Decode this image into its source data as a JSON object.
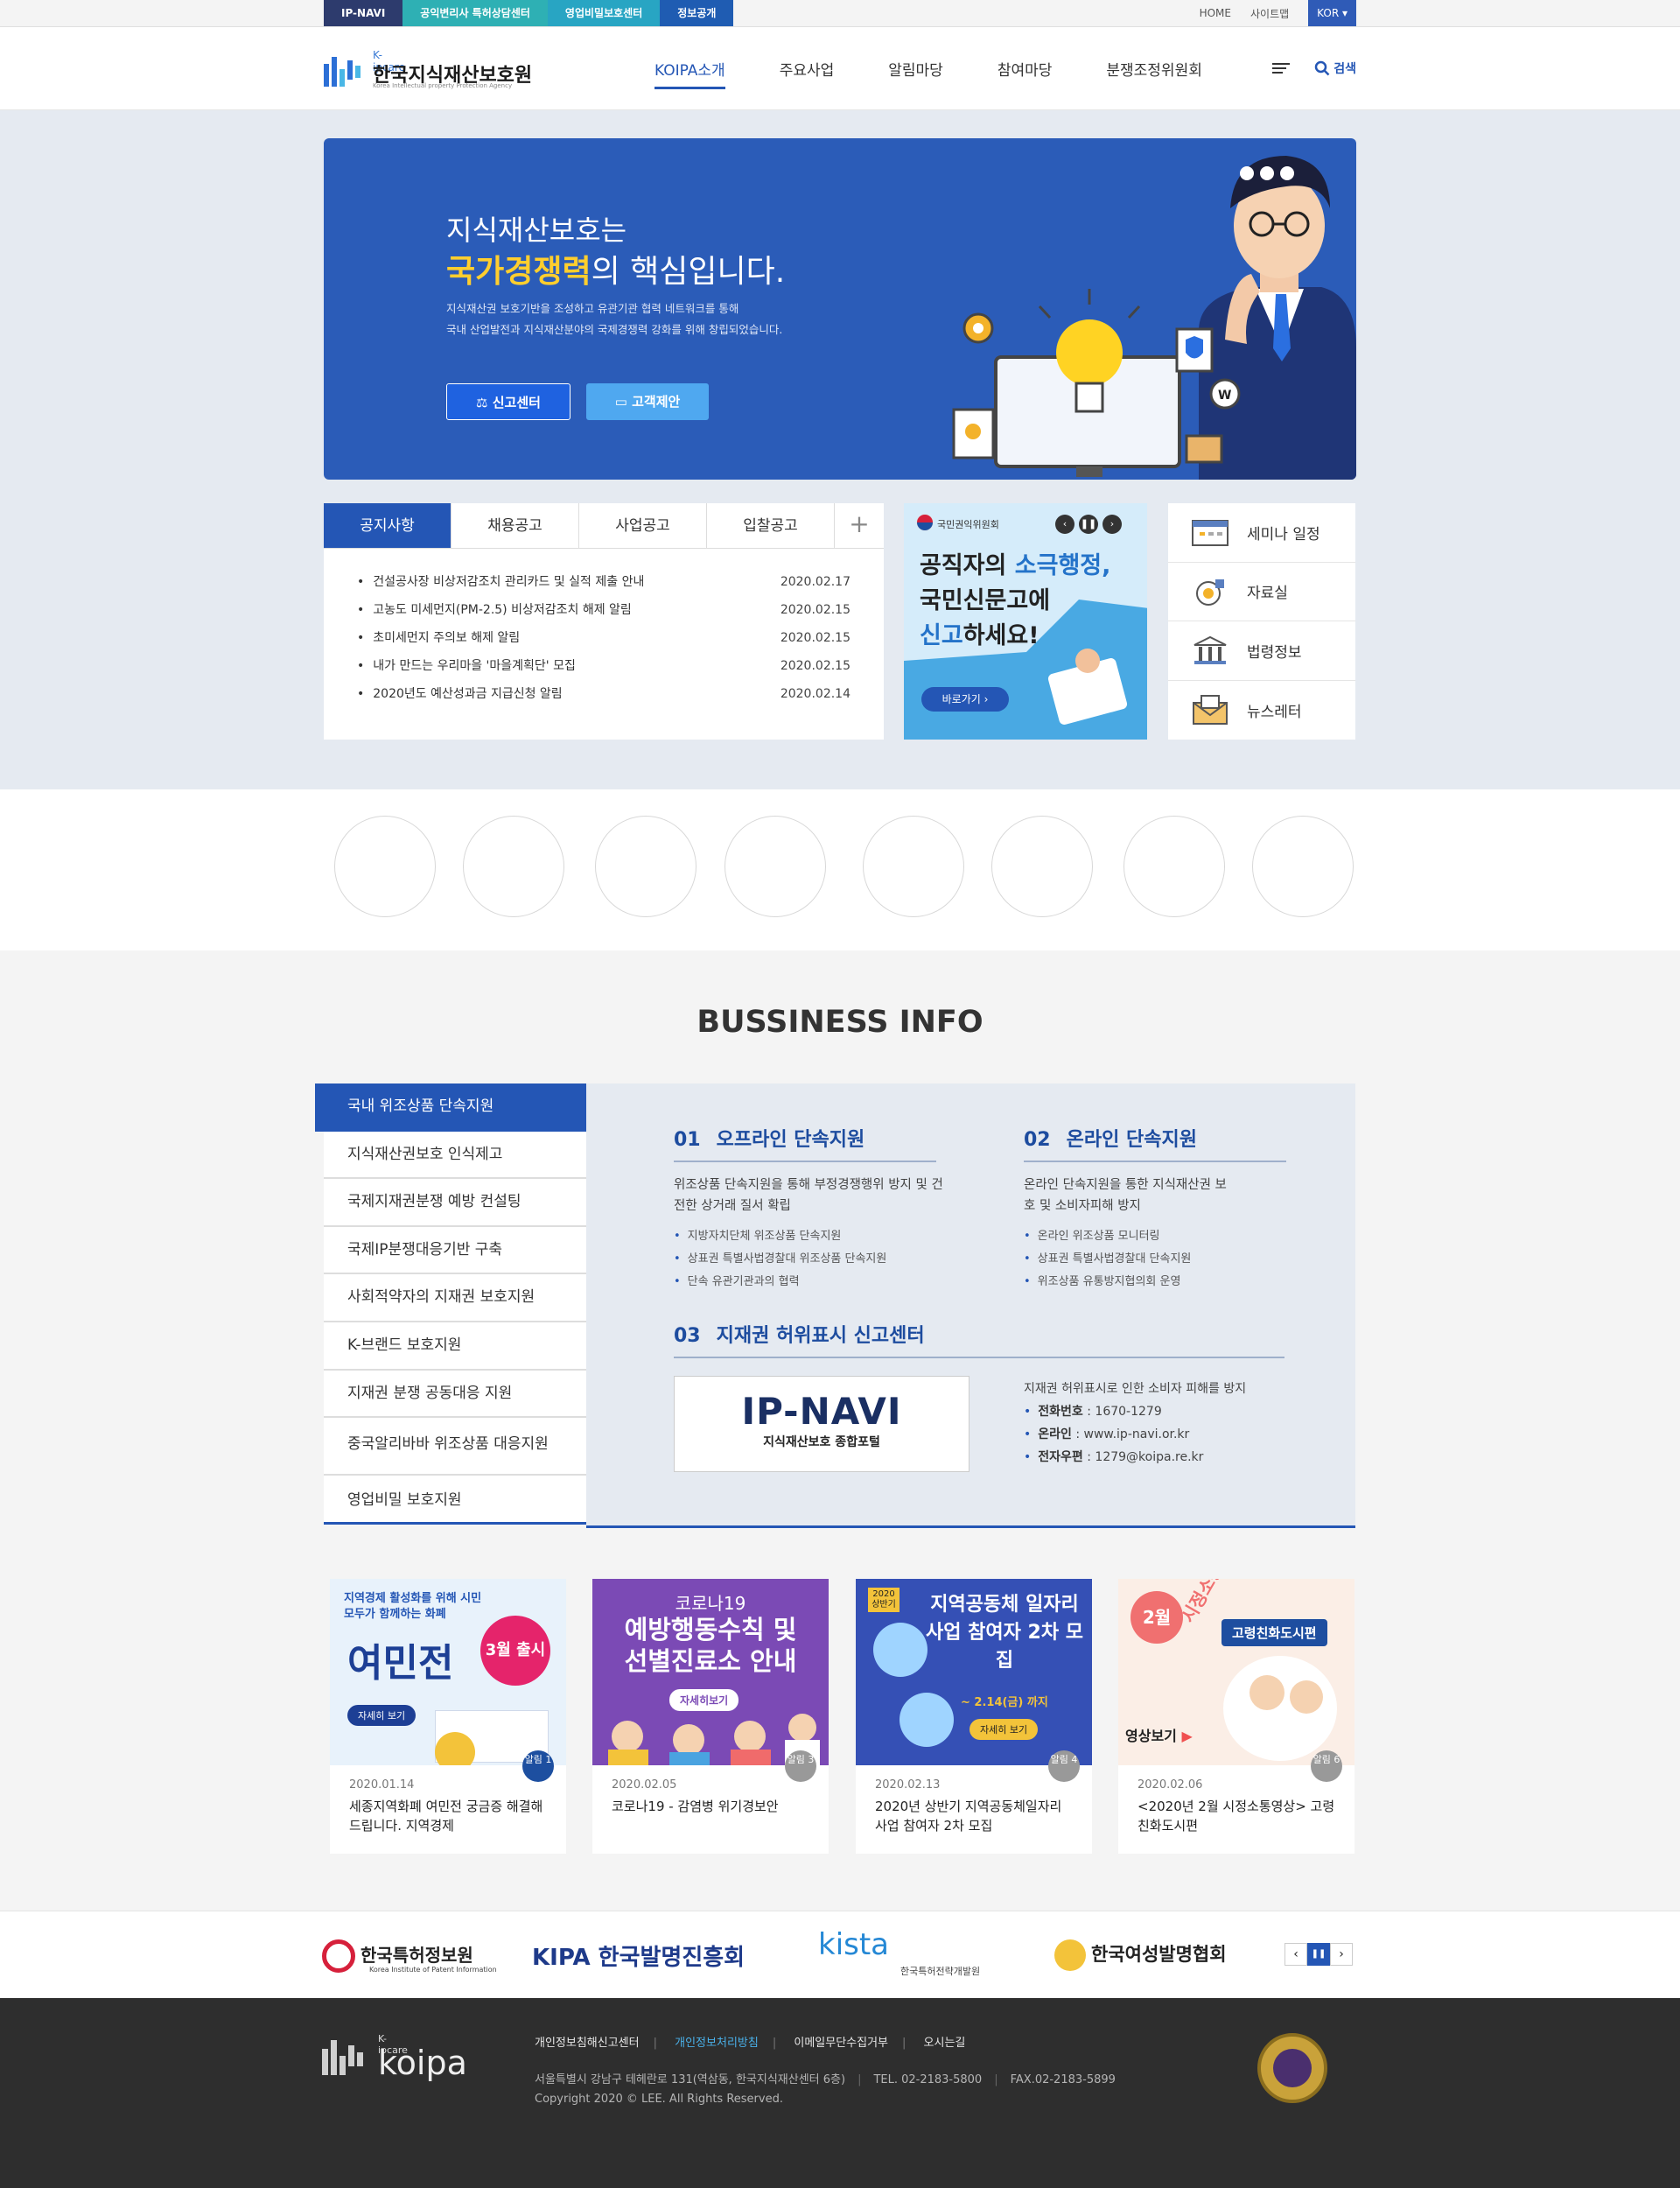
{
  "topbar": {
    "tabs": [
      "IP-NAVI",
      "공익변리사 특허상담센터",
      "영업비밀보호센터",
      "정보공개"
    ],
    "tab_colors": [
      "#2d3b6d",
      "#2eb0b4",
      "#28a5c3",
      "#1f5cb2"
    ],
    "home": "HOME",
    "sitemap": "사이트맵",
    "lang": "KOR"
  },
  "header": {
    "logo_sub": "K-ipcare",
    "logo_name": "한국지식재산보호원",
    "logo_en": "Korea Intellectual property Protection Agency",
    "nav": [
      "KOIPA소개",
      "주요사업",
      "알림마당",
      "참여마당",
      "분쟁조정위원회"
    ],
    "search": "검색"
  },
  "hero": {
    "title1": "지식재산보호는",
    "title2_bold": "국가경쟁력",
    "title2_rest": "의 핵심입니다.",
    "desc1": "지식재산권 보호기반을 조성하고 유관기관 협력 네트워크를 통해",
    "desc2": "국내 산업발전과 지식재산분야의 국제경쟁력 강화를 위해 창립되었습니다.",
    "btn1": "신고센터",
    "btn2": "고객제안"
  },
  "notice": {
    "tabs": [
      "공지사항",
      "채용공고",
      "사업공고",
      "입찰공고"
    ],
    "more": "+",
    "items": [
      {
        "title": "건설공사장 비상저감조치 관리카드 및 실적 제출 안내",
        "date": "2020.02.17"
      },
      {
        "title": "고농도 미세먼지(PM-2.5) 비상저감조치 해제 알림",
        "date": "2020.02.15"
      },
      {
        "title": "초미세먼지 주의보 해제 알림",
        "date": "2020.02.15"
      },
      {
        "title": "내가 만드는 우리마을 '마을계획단' 모집",
        "date": "2020.02.15"
      },
      {
        "title": "2020년도 예산성과금 지급신청 알림",
        "date": "2020.02.14"
      }
    ]
  },
  "banner": {
    "org": "국민권익위원회",
    "line1a": "공직자의 ",
    "line1b": "소극행정,",
    "line2a": "국민신문고",
    "line2b": "에",
    "line3a": "신고",
    "line3b": "하세요!",
    "go": "바로가기 ›"
  },
  "quick": [
    "세미나 일정",
    "자료실",
    "법령정보",
    "뉴스레터"
  ],
  "business": {
    "title": "BUSSINESS INFO",
    "menu": [
      "국내 위조상품 단속지원",
      "지식재산권보호 인식제고",
      "국제지재권분쟁 예방 컨설팅",
      "국제IP분쟁대응기반 구축",
      "사회적약자의 지재권 보호지원",
      "K-브랜드 보호지원",
      "지재권 분쟁 공동대응 지원",
      "중국알리바바 위조상품 대응지원",
      "영업비밀 보호지원"
    ],
    "s1": {
      "num": "01",
      "title": "오프라인 단속지원",
      "desc": "위조상품 단속지원을 통해 부정경쟁행위 방지 및 건전한 상거래 질서 확립",
      "list": [
        "지방자치단체 위조상품 단속지원",
        "상표권 특별사법경찰대 위조상품 단속지원",
        "단속 유관기관과의 협력"
      ]
    },
    "s2": {
      "num": "02",
      "title": "온라인 단속지원",
      "desc": "온라인 단속지원을 통한 지식재산권 보호 및 소비자피해 방지",
      "list": [
        "온라인 위조상품 모니터링",
        "상표권 특별사법경찰대 단속지원",
        "위조상품 유통방지협의회 운영"
      ]
    },
    "s3": {
      "num": "03",
      "title": "지재권 허위표시 신고센터",
      "logo": "IP-NAVI",
      "logo_sub": "지식재산보호 종합포털",
      "desc": "지재권 허위표시로 인한 소비자 피해를 방지",
      "phone_label": "전화번호",
      "phone": " : 1670-1279",
      "online_label": "온라인",
      "online": " : www.ip-navi.or.kr",
      "mail_label": "전자우편",
      "mail": " : 1279@koipa.re.kr"
    }
  },
  "cards": [
    {
      "date": "2020.01.14",
      "title": "세종지역화폐 여민전 궁금증 해결해 드립니다. 지역경제",
      "badge": "알림 1",
      "img_title": "여민전",
      "img_sub": "지역경제 활성화를 위해 시민 모두가 함께하는 화폐",
      "img_tag": "3월 출시",
      "img_btn": "자세히 보기"
    },
    {
      "date": "2020.02.05",
      "title": "코로나19 - 감염병 위기경보안",
      "badge": "알림 3",
      "img_title": "예방행동수칙 및 선별진료소 안내",
      "img_sub": "코로나19",
      "img_btn": "자세히보기"
    },
    {
      "date": "2020.02.13",
      "title": "2020년 상반기 지역공동체일자리 사업 참여자 2차 모집",
      "badge": "알림 4",
      "img_title": "지역공동체 일자리사업 참여자 2차 모집",
      "img_sub": "~ 2.14(금) 까지",
      "img_tag": "2020 상반기",
      "img_btn": "자세히 보기"
    },
    {
      "date": "2020.02.06",
      "title": "<2020년 2월 시정소통영상> 고령친화도시편",
      "badge": "알림 6",
      "img_title": "고령친화도시편",
      "img_sub": "시정소통영상",
      "img_tag": "2월",
      "img_btn": "영상보기"
    }
  ],
  "partners": {
    "items": [
      "한국특허정보원",
      "KIPA 한국발명진흥회",
      "kista",
      "한국여성발명협회"
    ],
    "kista_sub": "한국특허전략개발원",
    "kipi_sub": "Korea Institute of Patent Information"
  },
  "footer": {
    "logo_sub": "K-ipcare",
    "logo": "koipa",
    "links": [
      "개인정보침해신고센터",
      "개인정보처리방침",
      "이메일무단수집거부",
      "오시는길"
    ],
    "addr": "서울특별시 강남구 테헤란로 131(역삼동, 한국지식재산센터 6층)",
    "tel": "TEL. 02-2183-5800",
    "fax": "FAX.02-2183-5899",
    "copyright": "Copyright 2020 © LEE. All Rights Reserved."
  }
}
